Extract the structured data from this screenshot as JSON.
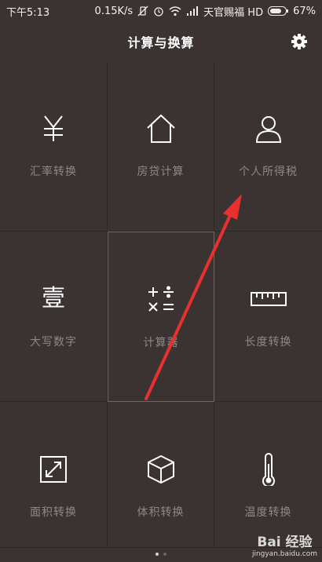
{
  "status_bar": {
    "time": "下午5:13",
    "speed": "0.15K/s",
    "carrier": "天官赐福 HD",
    "battery": "67%"
  },
  "header": {
    "title": "计算与换算"
  },
  "tiles": [
    {
      "label": "汇率转换",
      "icon": "currency-yuan-icon"
    },
    {
      "label": "房贷计算",
      "icon": "house-icon"
    },
    {
      "label": "个人所得税",
      "icon": "person-icon"
    },
    {
      "label": "大写数字",
      "icon": "chinese-numeral-icon",
      "glyph": "壹"
    },
    {
      "label": "计算器",
      "icon": "calculator-icon"
    },
    {
      "label": "长度转换",
      "icon": "ruler-icon"
    },
    {
      "label": "面积转换",
      "icon": "area-icon"
    },
    {
      "label": "体积转换",
      "icon": "cube-icon"
    },
    {
      "label": "温度转换",
      "icon": "thermometer-icon"
    }
  ],
  "watermark": {
    "brand": "Bai 经验",
    "url": "jingyan.baidu.com"
  },
  "colors": {
    "background": "#3a3332",
    "label": "#8d8887",
    "arrow": "#e8312e"
  }
}
